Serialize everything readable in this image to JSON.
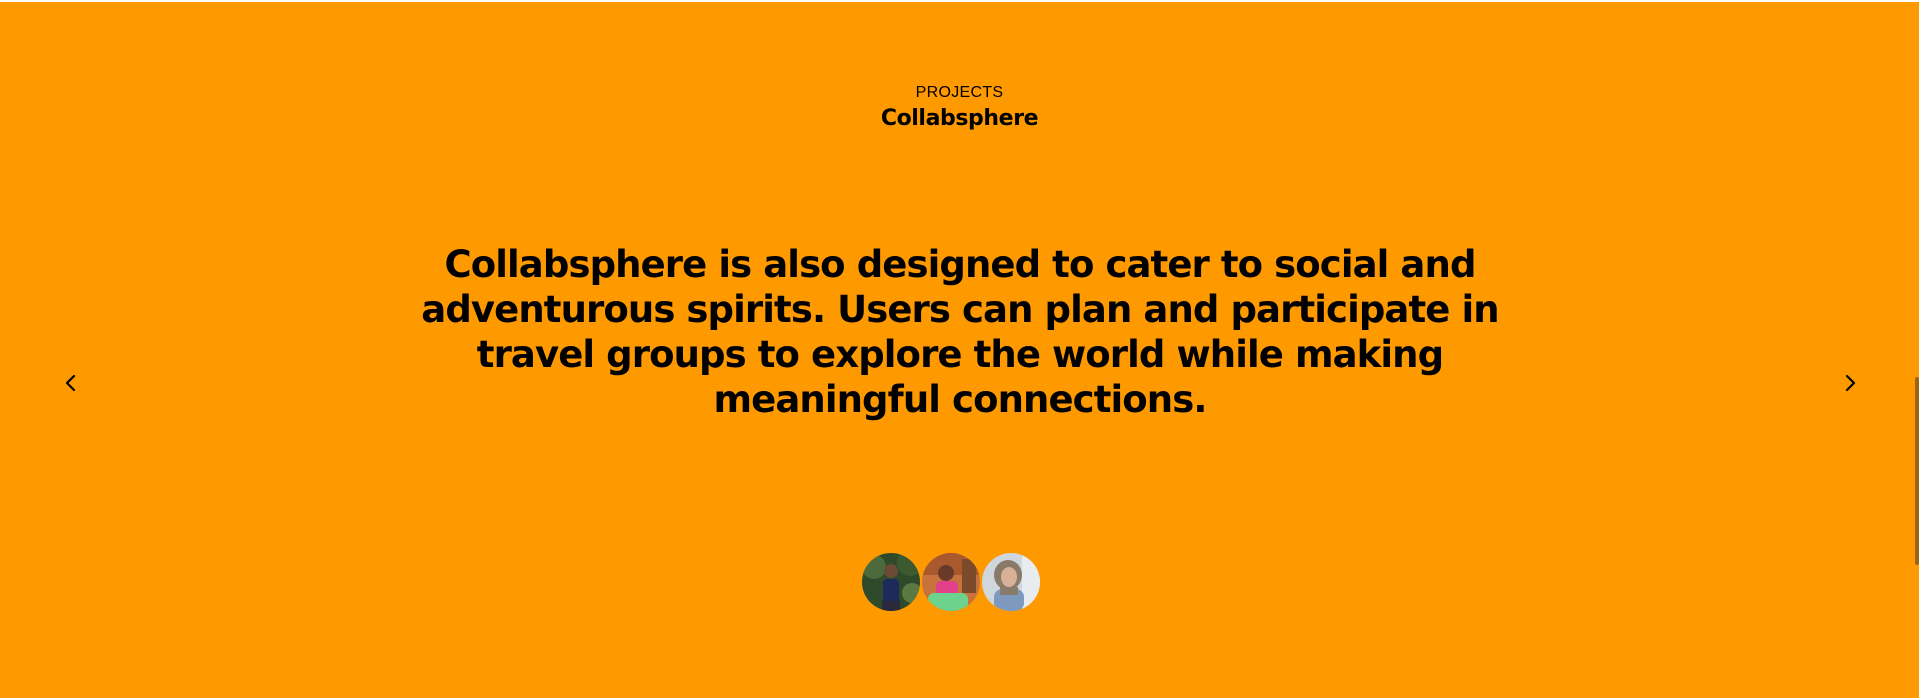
{
  "section": {
    "eyebrow": "PROJECTS",
    "project_name": "Collabsphere",
    "quote": "Collabsphere is also designed to cater to social and adventurous spirits. Users can plan and participate in travel groups to explore the world while making meaningful connections."
  },
  "colors": {
    "background": "#fe9900",
    "text": "#000000"
  },
  "navigation": {
    "prev_icon": "chevron-left-icon",
    "next_icon": "chevron-right-icon"
  },
  "avatars": [
    {
      "name": "avatar-1"
    },
    {
      "name": "avatar-2"
    },
    {
      "name": "avatar-3"
    }
  ]
}
